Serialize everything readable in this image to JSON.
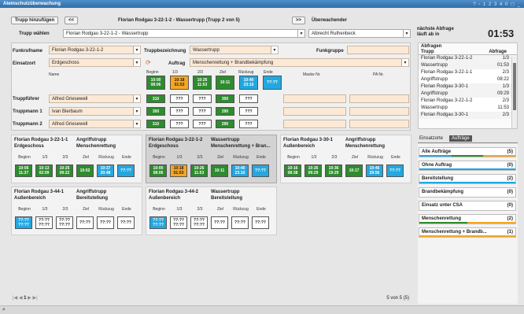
{
  "window": {
    "title": "Atemschutzüberwachung",
    "controls": "? ▫ 1 2 3 4 0 ◻ _"
  },
  "toolbar": {
    "add_label": "Trupp hinzufügen",
    "prev_label": "<<",
    "next_label": ">>",
    "center_title": "Florian Rodgau 3-22-1-2 - Wassertrupp (Trupp 2 von 5)",
    "supervisor_label": "Überwachender",
    "select_label": "Trupp wählen",
    "select_value": "Florian Rodgau 3-22-1-2 - Wassertrupp",
    "supervisor_value": "Albrecht Ruthenbeck",
    "next_check_label": "nächste Abfrage läuft ab in",
    "next_check_time": "01:53"
  },
  "form": {
    "funkrufname_label": "Funkrufname",
    "funkrufname_value": "Florian Rodgau 3-22-1-2",
    "truppbez_label": "Truppbezeichnung",
    "truppbez_value": "Wassertrupp",
    "funkgruppe_label": "Funkgruppe",
    "funkgruppe_value": "",
    "einsatzort_label": "Einsatzort",
    "einsatzort_value": "Erdgeschoss",
    "auftrag_label": "Auftrag",
    "auftrag_value": "Menschenrettung + Brandbekämpfung",
    "headers": {
      "name": "Name",
      "beginn": "Beginn",
      "d13": "1/3",
      "d23": "2/3",
      "ziel": "Ziel",
      "rueckzug": "Rückzug",
      "ende": "Ende",
      "maske": "Maske Nr.",
      "pa": "PA Nr."
    },
    "status": [
      {
        "t": "10:00",
        "b": "08:06",
        "c": "g"
      },
      {
        "t": "10:18",
        "b": "01:53",
        "c": "o"
      },
      {
        "t": "10:26",
        "b": "11:53",
        "c": "g"
      },
      {
        "t": "10:11",
        "b": "",
        "c": "g"
      },
      {
        "t": "10:40",
        "b": "23:10",
        "c": "b"
      },
      {
        "t": "??:??",
        "b": "",
        "c": "b"
      }
    ],
    "members": [
      {
        "role": "Truppführer",
        "name": "Alfred Griesewell",
        "p": "310",
        "v": [
          "???",
          "???",
          "300",
          "???"
        ]
      },
      {
        "role": "Truppmann 1",
        "name": "Ivan Bierbaum",
        "p": "300",
        "v": [
          "???",
          "???",
          "290",
          "???"
        ]
      },
      {
        "role": "Truppmann 2",
        "name": "Alfred Griesewell",
        "p": "310",
        "v": [
          "???",
          "???",
          "290",
          "???"
        ]
      }
    ]
  },
  "cards": [
    {
      "name": "Florian Rodgau 3-22-1-1",
      "type": "Angriffstrupp",
      "place": "Erdgeschoss",
      "task": "Menschenrettung",
      "sel": false,
      "st": [
        [
          "10:05",
          "11:37",
          "g"
        ],
        [
          "10:13",
          "02:09",
          "g"
        ],
        [
          "10:25",
          "09:22",
          "g"
        ],
        [
          "10:02",
          "",
          "g"
        ],
        [
          "10:37",
          "20:48",
          "b"
        ],
        [
          "??:??",
          "",
          "b"
        ]
      ]
    },
    {
      "name": "Florian Rodgau 3-22-1-2",
      "type": "Wassertrupp",
      "place": "Erdgeschoss",
      "task": "Menschenrettung + Bran...",
      "sel": true,
      "st": [
        [
          "10:00",
          "08:06",
          "g"
        ],
        [
          "10:18",
          "01:53",
          "o"
        ],
        [
          "10:26",
          "11:53",
          "g"
        ],
        [
          "10:11",
          "",
          "g"
        ],
        [
          "10:40",
          "23:10",
          "b"
        ],
        [
          "??:??",
          "",
          "b"
        ]
      ]
    },
    {
      "name": "Florian Rodgau 3-30-1",
      "type": "Angriffstrupp",
      "place": "Außenbereich",
      "task": "Menschenrettung",
      "sel": false,
      "st": [
        [
          "10:16",
          "08:38",
          "g"
        ],
        [
          "10:26",
          "09:29",
          "g"
        ],
        [
          "10:36",
          "19:29",
          "g"
        ],
        [
          "10:17",
          "",
          "g"
        ],
        [
          "10:46",
          "29:56",
          "b"
        ],
        [
          "??:??",
          "",
          "b"
        ]
      ]
    },
    {
      "name": "Florian Rodgau 3-44-1",
      "type": "Angriffstrupp",
      "place": "Außenbereich",
      "task": "Bereitstellung",
      "sel": false,
      "st": [
        [
          "??:??",
          "??:??",
          "b"
        ],
        [
          "??:??",
          "??:??",
          "w"
        ],
        [
          "??:??",
          "??:??",
          "w"
        ],
        [
          "??:??",
          "",
          "w"
        ],
        [
          "??:??",
          "",
          "w"
        ],
        [
          "??:??",
          "",
          "w"
        ]
      ]
    },
    {
      "name": "Florian Rodgau 3-44-2",
      "type": "Wassertrupp",
      "place": "Außenbereich",
      "task": "Bereitstellung",
      "sel": false,
      "st": [
        [
          "??:??",
          "??:??",
          "b"
        ],
        [
          "??:??",
          "??:??",
          "w"
        ],
        [
          "??:??",
          "??:??",
          "w"
        ],
        [
          "??:??",
          "",
          "w"
        ],
        [
          "??:??",
          "",
          "w"
        ],
        [
          "??:??",
          "",
          "w"
        ]
      ]
    }
  ],
  "card_headers": [
    "Beginn",
    "1/3",
    "2/3",
    "Ziel",
    "Rückzug",
    "Ende"
  ],
  "pager": {
    "text": "5 von 5 (5)",
    "page": "1"
  },
  "abfragen": {
    "title": "Abfragen",
    "col1": "Trupp",
    "col2": "Abfrage",
    "rows": [
      [
        "Florian Rodgau 3-22-1-2",
        "1/3"
      ],
      [
        "Wassertrupp",
        "01:53"
      ],
      [
        "Florian Rodgau 3-22-1-1",
        "2/3"
      ],
      [
        "Angriffstrupp",
        "08:22"
      ],
      [
        "Florian Rodgau 3-30-1",
        "1/3"
      ],
      [
        "Angriffstrupp",
        "09:29"
      ],
      [
        "Florian Rodgau 3-22-1-2",
        "2/3"
      ],
      [
        "Wassertrupp",
        "11:53"
      ],
      [
        "Florian Rodgau 3-30-1",
        "2/3"
      ]
    ]
  },
  "tabs": {
    "einsatzorte": "Einsatzorte",
    "auftraege": "Aufträge"
  },
  "auftraege": [
    {
      "label": "Alle Aufträge",
      "count": "(5)",
      "bars": [
        "#23a7e0",
        "#2e8b2e",
        "#f5a623"
      ]
    },
    {
      "label": "Ohne Auftrag",
      "count": "(0)",
      "bars": [
        "#23a7e0"
      ]
    },
    {
      "label": "Bereitstellung",
      "count": "(2)",
      "bars": [
        "#23a7e0"
      ]
    },
    {
      "label": "Brandbekämpfung",
      "count": "(0)",
      "bars": []
    },
    {
      "label": "Einsatz unter CSA",
      "count": "(0)",
      "bars": []
    },
    {
      "label": "Menschenrettung",
      "count": "(2)",
      "bars": [
        "#2e8b2e",
        "#f5a623"
      ]
    },
    {
      "label": "Menschenrettung + Brandb...",
      "count": "(1)",
      "bars": [
        "#f5a623"
      ]
    }
  ]
}
